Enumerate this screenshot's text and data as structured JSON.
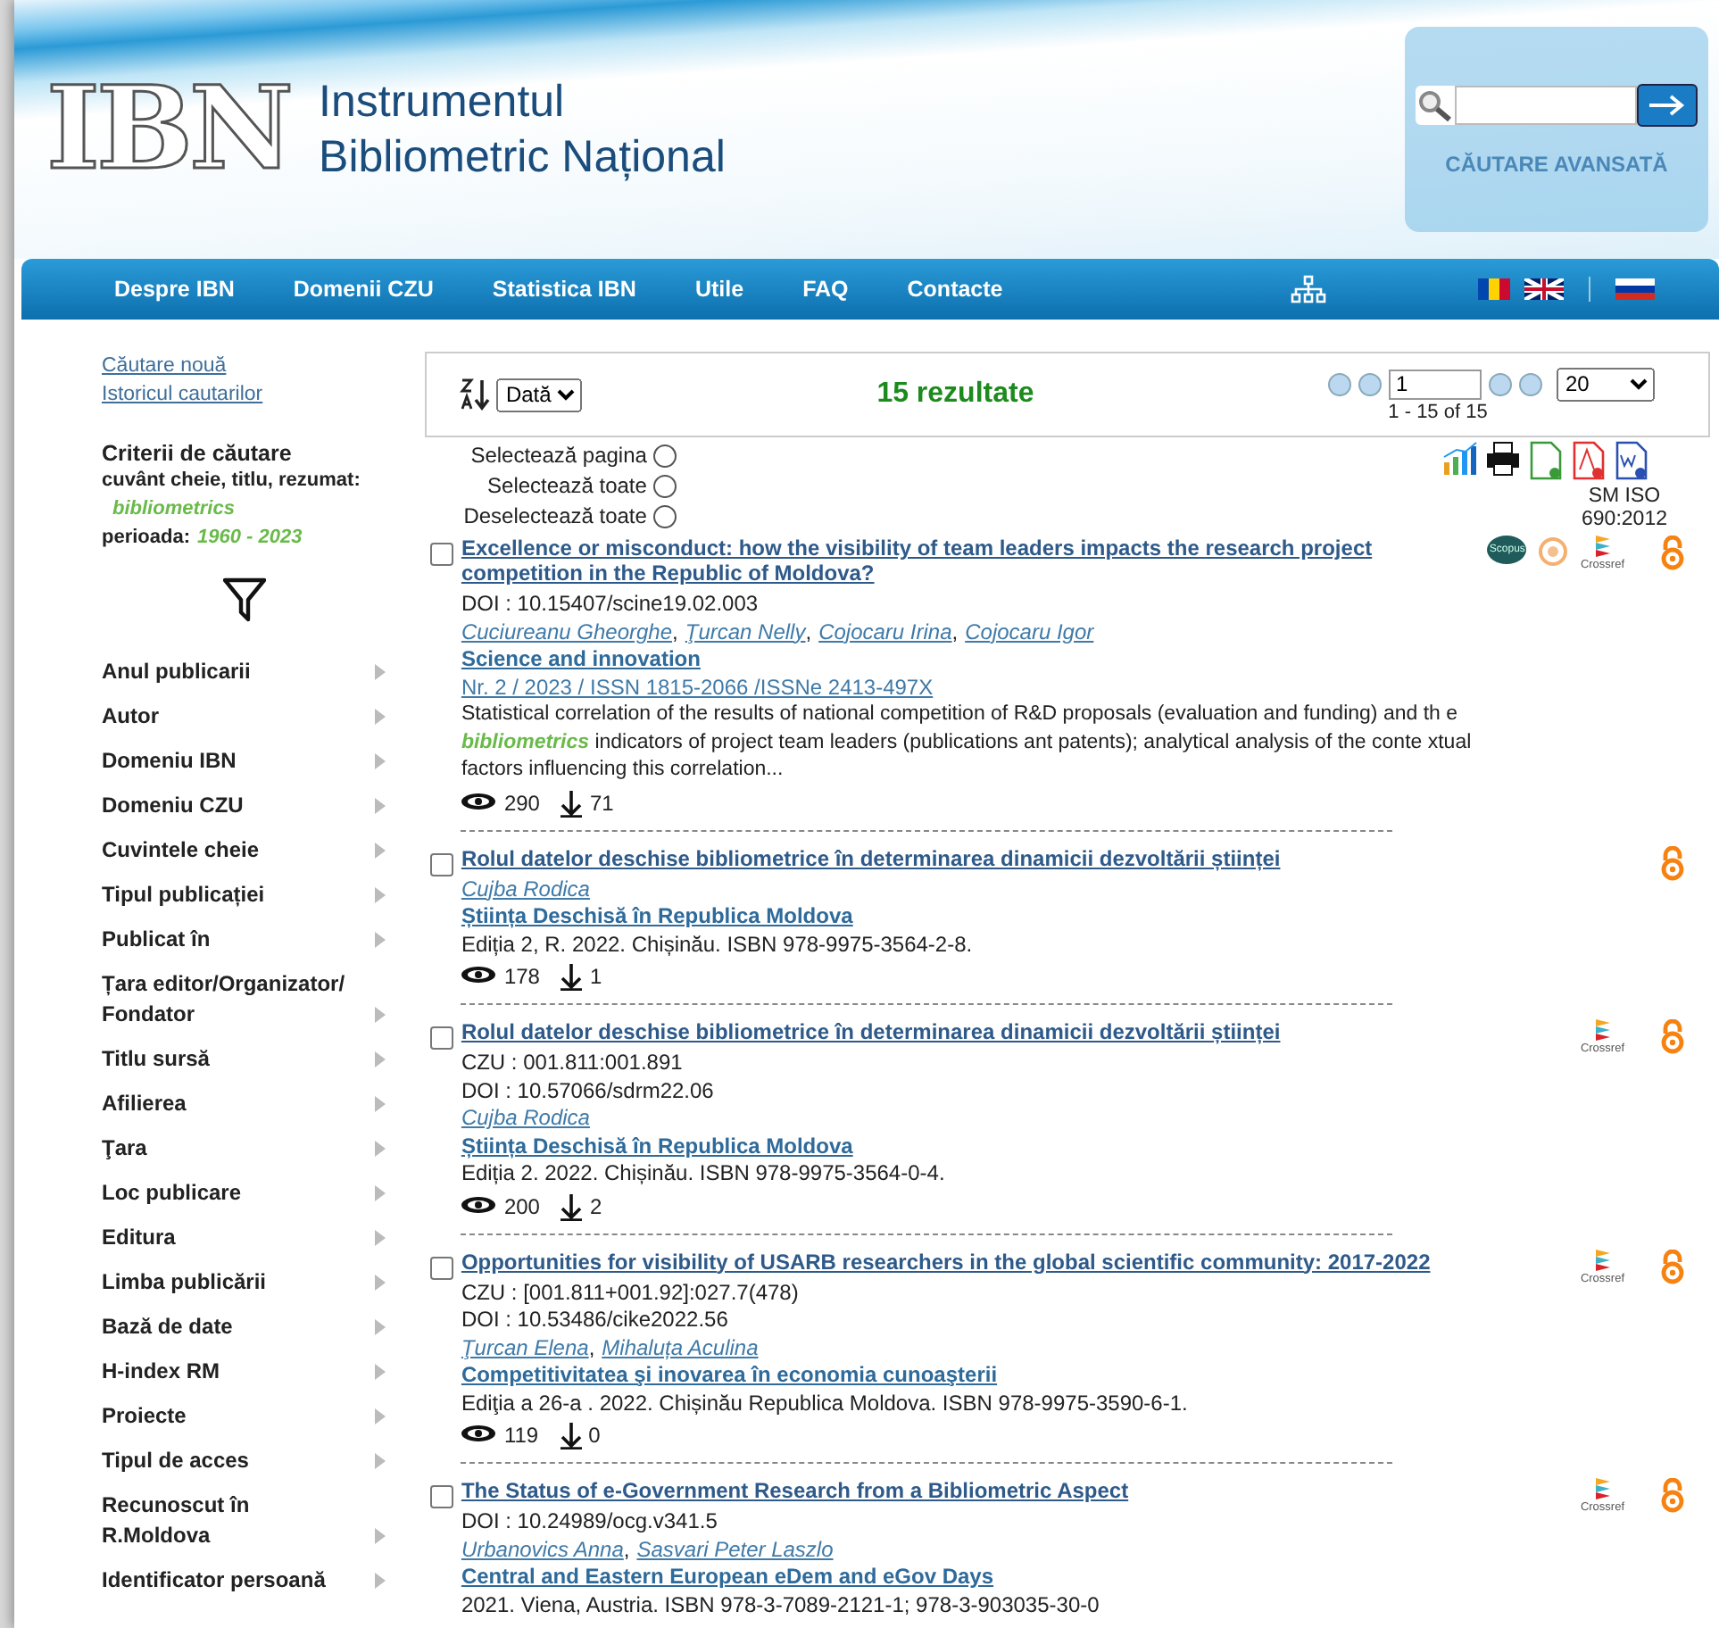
{
  "header": {
    "logo_text": "IBN",
    "title_line1": "Instrumentul",
    "title_line2": "Bibliometric Național",
    "advanced_search": "CĂUTARE AVANSATĂ"
  },
  "nav": [
    {
      "label": "Despre IBN"
    },
    {
      "label": "Domenii CZU"
    },
    {
      "label": "Statistica IBN"
    },
    {
      "label": "Utile"
    },
    {
      "label": "FAQ"
    },
    {
      "label": "Contacte"
    }
  ],
  "sidebar": {
    "links": [
      "Căutare nouă",
      "Istoricul cautarilor"
    ],
    "criteria_title": "Criterii de căutare",
    "criteria": [
      {
        "label": "cuvânt cheie, titlu, rezumat:",
        "value": "bibliometrics",
        "inline": false
      },
      {
        "label": "perioada:",
        "value": "1960 - 2023",
        "inline": true
      }
    ],
    "filters": [
      "Anul publicarii",
      "Autor",
      "Domeniu IBN",
      "Domeniu CZU",
      "Cuvintele cheie",
      "Tipul publicației",
      "Publicat în",
      "Țara editor/Organizator/ Fondator",
      "Titlu sursă",
      "Afilierea",
      "Ţara",
      "Loc publicare",
      "Editura",
      "Limba publicării",
      "Bază de date",
      "H-index RM",
      "Proiecte",
      "Tipul de acces",
      "Recunoscut în R.Moldova",
      "Identificator persoană"
    ]
  },
  "toolbar": {
    "sort": "Dată",
    "count": "15 rezultate",
    "page": "1",
    "range": "1 - 15 of 15",
    "per_page": "20"
  },
  "selection": [
    {
      "label": "Selectează pagina",
      "selected": false
    },
    {
      "label": "Selectează toate",
      "selected": false
    },
    {
      "label": "Deselectează toate",
      "selected": false
    }
  ],
  "export_label": "SM ISO 690:2012",
  "results": [
    {
      "title": "Excellence or misconduct: how the visibility of team leaders impacts the research project competition in the Republic of Moldova?",
      "checked": false,
      "badges": [
        {
          "kind": "scopus",
          "label": "Scopus"
        },
        {
          "kind": "seal"
        },
        {
          "kind": "crossref",
          "label": "Crossref"
        }
      ],
      "open_access": true,
      "lines": [
        {
          "kind": "plain",
          "text": "DOI : 10.15407/scine19.02.003"
        },
        {
          "kind": "authors",
          "separator": ",",
          "items": [
            "Cuciureanu Gheorghe",
            "Ţurcan Nelly",
            "Cojocaru Irina",
            "Cojocaru Igor"
          ]
        },
        {
          "kind": "source",
          "text": "Science and innovation"
        },
        {
          "kind": "issue",
          "text": "Nr. 2 / 2023 / ISSN 1815-2066 /ISSNe 2413-497X"
        },
        {
          "kind": "abstract",
          "text": "Statistical correlation of the results of national competition of R&D proposals (evaluation and funding) and th e *bibliometrics* indicators of project team leaders (publications ant patents); analytical analysis of the conte xtual factors influencing this correlation..."
        }
      ],
      "views": "290",
      "downloads": "71"
    },
    {
      "title": "Rolul datelor deschise bibliometrice în determinarea dinamicii dezvoltării științei",
      "checked": false,
      "open_access": true,
      "lines": [
        {
          "kind": "authors",
          "items": [
            "Cujba Rodica"
          ]
        },
        {
          "kind": "source",
          "text": "Știința Deschisă în Republica Moldova"
        },
        {
          "kind": "plain",
          "text": "Ediția 2, R. 2022. Chișinău. ISBN 978-9975-3564-2-8."
        }
      ],
      "views": "178",
      "downloads": "1"
    },
    {
      "title": "Rolul datelor deschise bibliometrice în determinarea dinamicii dezvoltării științei",
      "checked": false,
      "badges": [
        {
          "kind": "crossref",
          "label": "Crossref"
        }
      ],
      "open_access": true,
      "lines": [
        {
          "kind": "plain",
          "text": "CZU : 001.811:001.891"
        },
        {
          "kind": "plain",
          "text": "DOI : 10.57066/sdrm22.06"
        },
        {
          "kind": "authors",
          "items": [
            "Cujba Rodica"
          ]
        },
        {
          "kind": "source",
          "text": "Știința Deschisă în Republica Moldova"
        },
        {
          "kind": "plain",
          "text": "Ediția 2. 2022. Chișinău. ISBN 978-9975-3564-0-4."
        }
      ],
      "views": "200",
      "downloads": "2"
    },
    {
      "title": "Opportunities for visibility of USARB researchers in the global scientific community: 2017-2022",
      "checked": false,
      "badges": [
        {
          "kind": "crossref",
          "label": "Crossref"
        }
      ],
      "open_access": true,
      "lines": [
        {
          "kind": "plain",
          "text": "CZU : [001.811+001.92]:027.7(478)"
        },
        {
          "kind": "plain",
          "text": "DOI : 10.53486/cike2022.56"
        },
        {
          "kind": "authors",
          "separator": ",",
          "items": [
            "Ţurcan Elena",
            "Mihaluța Aculina"
          ]
        },
        {
          "kind": "source",
          "text": "Competitivitatea şi inovarea în economia cunoaşterii"
        },
        {
          "kind": "plain",
          "text": "Ediţia a 26-a . 2022. Chișinău Republica Moldova. ISBN 978-9975-3590-6-1."
        }
      ],
      "views": "119",
      "downloads": "0"
    },
    {
      "title": "The Status of e-Government Research from a Bibliometric Aspect",
      "checked": false,
      "badges": [
        {
          "kind": "crossref",
          "label": "Crossref"
        }
      ],
      "open_access": true,
      "lines": [
        {
          "kind": "plain",
          "text": "DOI : 10.24989/ocg.v341.5"
        },
        {
          "kind": "authors",
          "separator": ",",
          "items": [
            "Urbanovics Anna",
            "Sasvari Peter Laszlo"
          ]
        },
        {
          "kind": "source",
          "text": "Central and Eastern European eDem and eGov Days"
        },
        {
          "kind": "plain",
          "text": "2021. Viena, Austria. ISBN 978-3-7089-2121-1; 978-3-903035-30-0"
        }
      ]
    }
  ]
}
